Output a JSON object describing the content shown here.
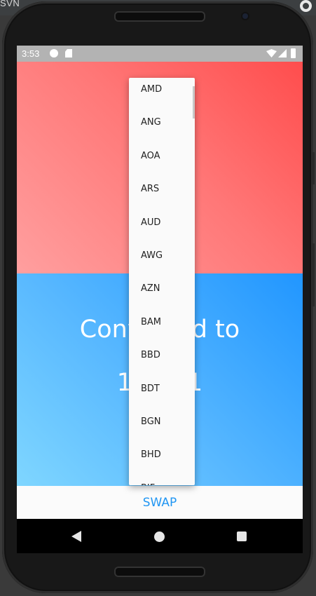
{
  "emulator": {
    "window_title": "SVN"
  },
  "status_bar": {
    "time": "3:53",
    "icons": [
      "notification-icon",
      "sd-card-icon",
      "wifi-icon",
      "signal-icon",
      "battery-icon"
    ]
  },
  "colors": {
    "top_panel": "#ff6b6b",
    "bottom_panel": "#42a5ff",
    "accent": "#2196f3",
    "status_bar": "#b3b3b3"
  },
  "main": {
    "converted_label": "Converted to",
    "converted_value": "117.81"
  },
  "dropdown": {
    "items": [
      "AMD",
      "ANG",
      "AOA",
      "ARS",
      "AUD",
      "AWG",
      "AZN",
      "BAM",
      "BBD",
      "BDT",
      "BGN",
      "BHD",
      "BIF"
    ]
  },
  "swap": {
    "label": "SWAP"
  },
  "nav_bar": {
    "icons": [
      "back-icon",
      "home-icon",
      "recents-icon"
    ]
  }
}
